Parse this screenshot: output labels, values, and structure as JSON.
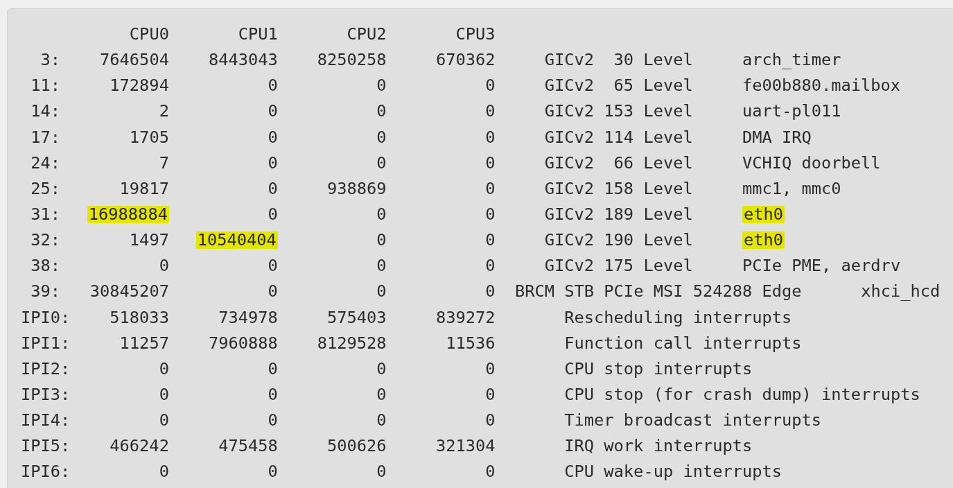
{
  "header": [
    "CPU0",
    "CPU1",
    "CPU2",
    "CPU3"
  ],
  "rows": [
    {
      "kind": "irq",
      "irq": "3:",
      "counts": [
        {
          "value": "7646504",
          "highlighted": false
        },
        {
          "value": "8443043",
          "highlighted": false
        },
        {
          "value": "8250258",
          "highlighted": false
        },
        {
          "value": "670362",
          "highlighted": false
        }
      ],
      "chip": "GICv2",
      "hwirq": "30",
      "trigger": "Level",
      "name": {
        "text": "arch_timer",
        "highlighted": false
      }
    },
    {
      "kind": "irq",
      "irq": "11:",
      "counts": [
        {
          "value": "172894",
          "highlighted": false
        },
        {
          "value": "0",
          "highlighted": false
        },
        {
          "value": "0",
          "highlighted": false
        },
        {
          "value": "0",
          "highlighted": false
        }
      ],
      "chip": "GICv2",
      "hwirq": "65",
      "trigger": "Level",
      "name": {
        "text": "fe00b880.mailbox",
        "highlighted": false
      }
    },
    {
      "kind": "irq",
      "irq": "14:",
      "counts": [
        {
          "value": "2",
          "highlighted": false
        },
        {
          "value": "0",
          "highlighted": false
        },
        {
          "value": "0",
          "highlighted": false
        },
        {
          "value": "0",
          "highlighted": false
        }
      ],
      "chip": "GICv2",
      "hwirq": "153",
      "trigger": "Level",
      "name": {
        "text": "uart-pl011",
        "highlighted": false
      }
    },
    {
      "kind": "irq",
      "irq": "17:",
      "counts": [
        {
          "value": "1705",
          "highlighted": false
        },
        {
          "value": "0",
          "highlighted": false
        },
        {
          "value": "0",
          "highlighted": false
        },
        {
          "value": "0",
          "highlighted": false
        }
      ],
      "chip": "GICv2",
      "hwirq": "114",
      "trigger": "Level",
      "name": {
        "text": "DMA IRQ",
        "highlighted": false
      }
    },
    {
      "kind": "irq",
      "irq": "24:",
      "counts": [
        {
          "value": "7",
          "highlighted": false
        },
        {
          "value": "0",
          "highlighted": false
        },
        {
          "value": "0",
          "highlighted": false
        },
        {
          "value": "0",
          "highlighted": false
        }
      ],
      "chip": "GICv2",
      "hwirq": "66",
      "trigger": "Level",
      "name": {
        "text": "VCHIQ doorbell",
        "highlighted": false
      }
    },
    {
      "kind": "irq",
      "irq": "25:",
      "counts": [
        {
          "value": "19817",
          "highlighted": false
        },
        {
          "value": "0",
          "highlighted": false
        },
        {
          "value": "938869",
          "highlighted": false
        },
        {
          "value": "0",
          "highlighted": false
        }
      ],
      "chip": "GICv2",
      "hwirq": "158",
      "trigger": "Level",
      "name": {
        "text": "mmc1, mmc0",
        "highlighted": false
      }
    },
    {
      "kind": "irq",
      "irq": "31:",
      "counts": [
        {
          "value": "16988884",
          "highlighted": true
        },
        {
          "value": "0",
          "highlighted": false
        },
        {
          "value": "0",
          "highlighted": false
        },
        {
          "value": "0",
          "highlighted": false
        }
      ],
      "chip": "GICv2",
      "hwirq": "189",
      "trigger": "Level",
      "name": {
        "text": "eth0",
        "highlighted": true
      }
    },
    {
      "kind": "irq",
      "irq": "32:",
      "counts": [
        {
          "value": "1497",
          "highlighted": false
        },
        {
          "value": "10540404",
          "highlighted": true
        },
        {
          "value": "0",
          "highlighted": false
        },
        {
          "value": "0",
          "highlighted": false
        }
      ],
      "chip": "GICv2",
      "hwirq": "190",
      "trigger": "Level",
      "name": {
        "text": "eth0",
        "highlighted": true
      }
    },
    {
      "kind": "irq",
      "irq": "38:",
      "counts": [
        {
          "value": "0",
          "highlighted": false
        },
        {
          "value": "0",
          "highlighted": false
        },
        {
          "value": "0",
          "highlighted": false
        },
        {
          "value": "0",
          "highlighted": false
        }
      ],
      "chip": "GICv2",
      "hwirq": "175",
      "trigger": "Level",
      "name": {
        "text": "PCIe PME, aerdrv",
        "highlighted": false
      }
    },
    {
      "kind": "irq",
      "irq": "39:",
      "counts": [
        {
          "value": "30845207",
          "highlighted": false
        },
        {
          "value": "0",
          "highlighted": false
        },
        {
          "value": "0",
          "highlighted": false
        },
        {
          "value": "0",
          "highlighted": false
        }
      ],
      "chip": "BRCM STB PCIe MSI",
      "hwirq": "524288",
      "trigger": "Edge",
      "name": {
        "text": "xhci_hcd",
        "highlighted": false
      }
    },
    {
      "kind": "ipi",
      "irq": "IPI0:",
      "counts": [
        {
          "value": "518033",
          "highlighted": false
        },
        {
          "value": "734978",
          "highlighted": false
        },
        {
          "value": "575403",
          "highlighted": false
        },
        {
          "value": "839272",
          "highlighted": false
        }
      ],
      "description": "Rescheduling interrupts"
    },
    {
      "kind": "ipi",
      "irq": "IPI1:",
      "counts": [
        {
          "value": "11257",
          "highlighted": false
        },
        {
          "value": "7960888",
          "highlighted": false
        },
        {
          "value": "8129528",
          "highlighted": false
        },
        {
          "value": "11536",
          "highlighted": false
        }
      ],
      "description": "Function call interrupts"
    },
    {
      "kind": "ipi",
      "irq": "IPI2:",
      "counts": [
        {
          "value": "0",
          "highlighted": false
        },
        {
          "value": "0",
          "highlighted": false
        },
        {
          "value": "0",
          "highlighted": false
        },
        {
          "value": "0",
          "highlighted": false
        }
      ],
      "description": "CPU stop interrupts"
    },
    {
      "kind": "ipi",
      "irq": "IPI3:",
      "counts": [
        {
          "value": "0",
          "highlighted": false
        },
        {
          "value": "0",
          "highlighted": false
        },
        {
          "value": "0",
          "highlighted": false
        },
        {
          "value": "0",
          "highlighted": false
        }
      ],
      "description": "CPU stop (for crash dump) interrupts"
    },
    {
      "kind": "ipi",
      "irq": "IPI4:",
      "counts": [
        {
          "value": "0",
          "highlighted": false
        },
        {
          "value": "0",
          "highlighted": false
        },
        {
          "value": "0",
          "highlighted": false
        },
        {
          "value": "0",
          "highlighted": false
        }
      ],
      "description": "Timer broadcast interrupts"
    },
    {
      "kind": "ipi",
      "irq": "IPI5:",
      "counts": [
        {
          "value": "466242",
          "highlighted": false
        },
        {
          "value": "475458",
          "highlighted": false
        },
        {
          "value": "500626",
          "highlighted": false
        },
        {
          "value": "321304",
          "highlighted": false
        }
      ],
      "description": "IRQ work interrupts"
    },
    {
      "kind": "ipi",
      "irq": "IPI6:",
      "counts": [
        {
          "value": "0",
          "highlighted": false
        },
        {
          "value": "0",
          "highlighted": false
        },
        {
          "value": "0",
          "highlighted": false
        },
        {
          "value": "0",
          "highlighted": false
        }
      ],
      "description": "CPU wake-up interrupts"
    }
  ]
}
